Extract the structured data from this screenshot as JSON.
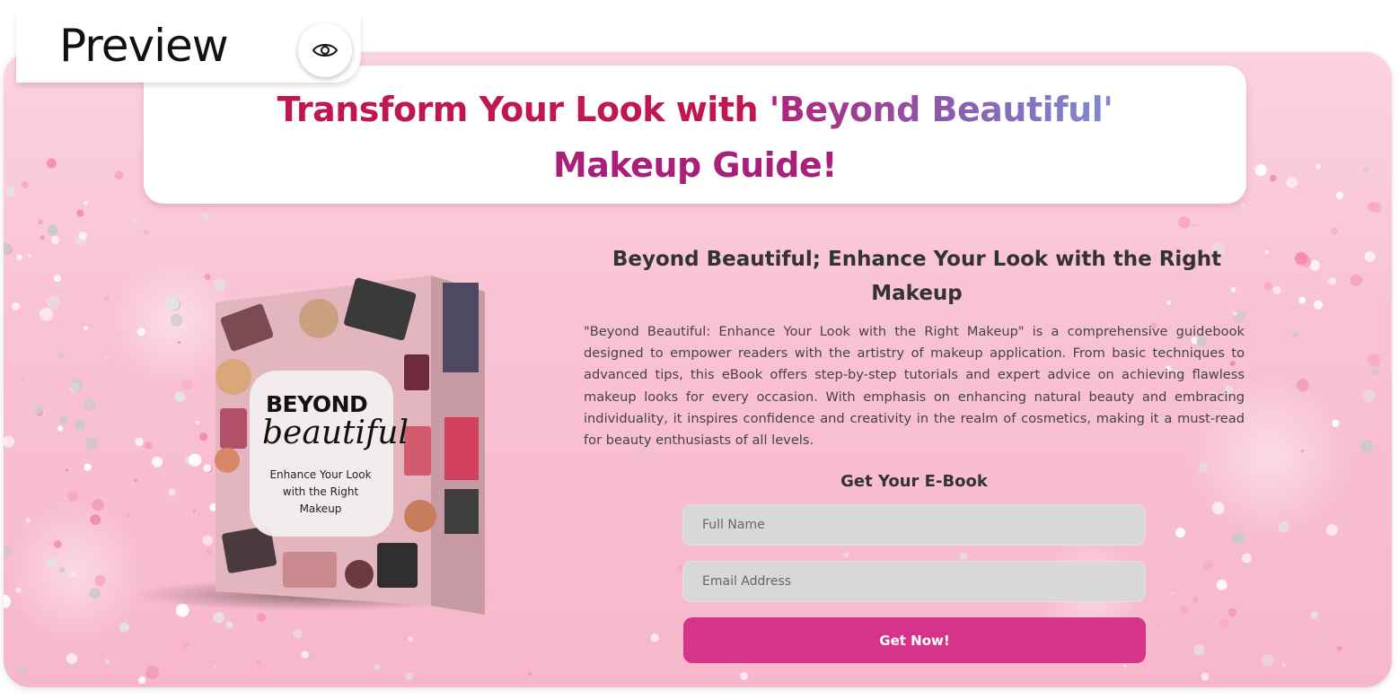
{
  "preview": {
    "label": "Preview",
    "icon": "eye-icon"
  },
  "header": {
    "headline_part1": "Transform Your Look with ",
    "headline_part2": "'Beyond Beautiful'",
    "headline_part3": "Makeup Guide!"
  },
  "book": {
    "title_line1": "BEYOND",
    "title_line2": "beautiful",
    "subtitle": "Enhance Your Look with the Right Makeup"
  },
  "content": {
    "sub_headline": "Beyond Beautiful; Enhance Your Look with the Right Makeup",
    "description": "\"Beyond Beautiful: Enhance Your Look with the Right Makeup\" is a comprehensive guidebook designed to empower readers with the artistry of makeup application. From basic techniques to advanced tips, this eBook offers step-by-step tutorials and expert advice on achieving flawless makeup looks for every occasion. With emphasis on enhancing natural beauty and embracing individuality, it inspires confidence and creativity in the realm of cosmetics, making it a must-read for beauty enthusiasts of all levels."
  },
  "form": {
    "heading": "Get Your E-Book",
    "name_placeholder": "Full Name",
    "email_placeholder": "Email Address",
    "submit_label": "Get Now!"
  },
  "colors": {
    "accent": "#d6338a",
    "headline_red": "#c01654",
    "headline_purple": "#8a5fb0",
    "background_pink": "#f9c3d4"
  }
}
